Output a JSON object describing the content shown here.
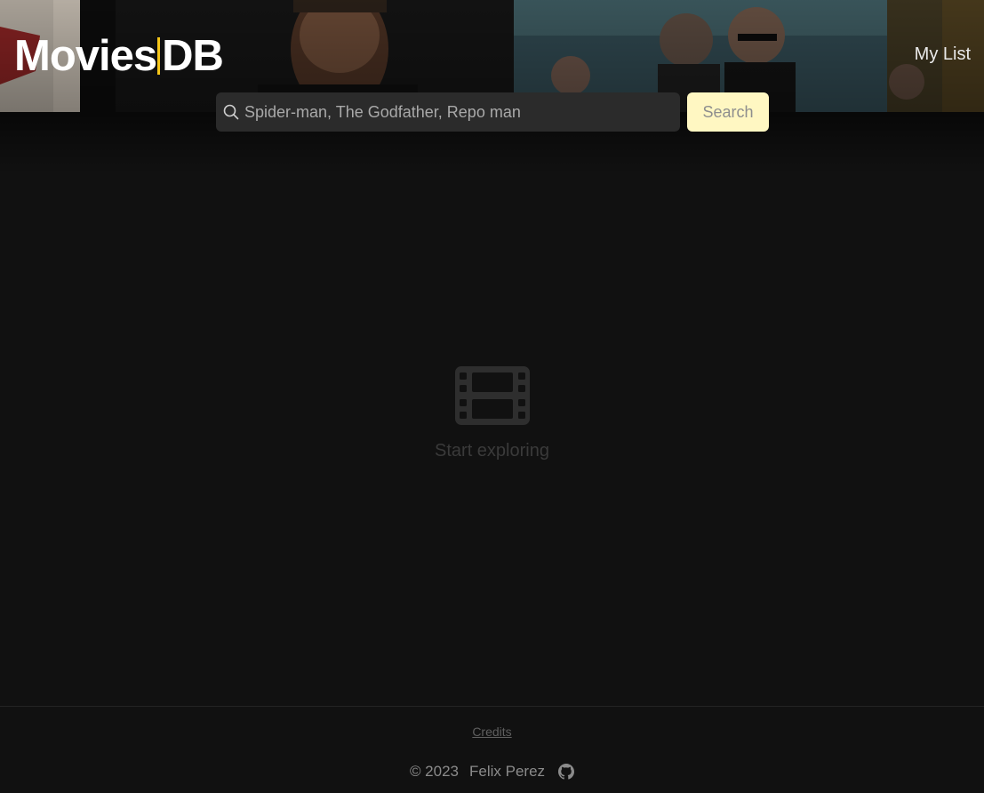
{
  "header": {
    "logo_left": "Movies",
    "logo_right": "DB",
    "nav_my_list": "My List"
  },
  "search": {
    "placeholder": "Spider-man, The Godfather, Repo man",
    "value": "",
    "button_label": "Search"
  },
  "main": {
    "empty_icon": "film-icon",
    "empty_label": "Start exploring"
  },
  "footer": {
    "credits_label": "Credits",
    "copyright": "© 2023",
    "author": "Felix Perez",
    "github_icon": "github-icon"
  },
  "colors": {
    "background": "#111111",
    "accent": "#f5c518",
    "search_button": "#fff7c2",
    "search_field": "#2b2b2b"
  }
}
